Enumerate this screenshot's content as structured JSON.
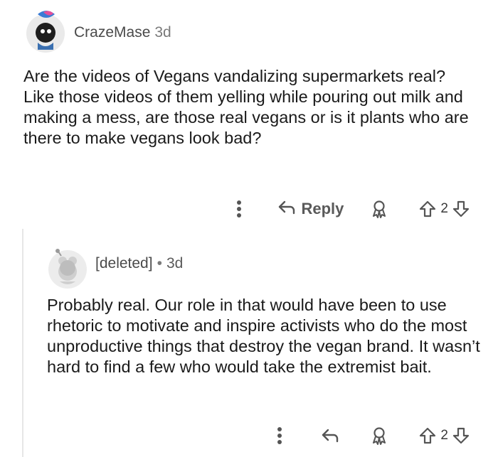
{
  "comment": {
    "username": "CrazeMase",
    "time": "3d",
    "body": "Are the videos of Vegans vandalizing supermarkets real? Like those videos of them yelling while pouring out milk and making a mess, are those real vegans or is it plants who are there to make vegans look bad?",
    "reply_label": "Reply",
    "vote_count": "2"
  },
  "reply": {
    "username": "[deleted]",
    "separator": "•",
    "time": "3d",
    "body": "Probably real. Our role in that would have been to use rhetoric to motivate and inspire activists who do the most unproductive things that destroy the vegan brand. It wasn’t hard to find a few who would take the extremist bait.",
    "vote_count": "2"
  },
  "icons": {
    "more": "more-options-icon",
    "reply": "reply-arrow-icon",
    "award": "award-icon",
    "upvote": "upvote-icon",
    "downvote": "downvote-icon"
  }
}
